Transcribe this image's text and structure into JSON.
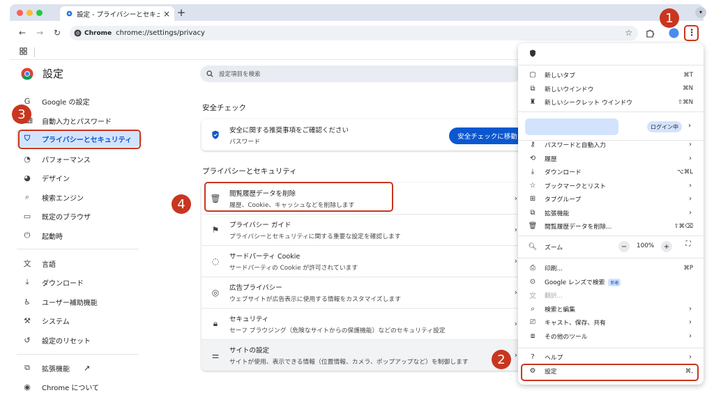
{
  "browser": {
    "tab_title": "設定 - プライバシーとセキュリティ",
    "tab_close": "×",
    "new_tab": "+",
    "site_chip": "Chrome",
    "url": "chrome://settings/privacy"
  },
  "settings": {
    "title": "設定",
    "search_placeholder": "設定項目を検索",
    "nav": [
      {
        "label": "Google の設定",
        "icon": "google-icon"
      },
      {
        "label": "自動入力とパスワード",
        "icon": "autofill-icon"
      },
      {
        "label": "プライバシーとセキュリティ",
        "icon": "shield-icon",
        "active": true
      },
      {
        "label": "パフォーマンス",
        "icon": "speedometer-icon"
      },
      {
        "label": "デザイン",
        "icon": "palette-icon"
      },
      {
        "label": "検索エンジン",
        "icon": "search-icon"
      },
      {
        "label": "既定のブラウザ",
        "icon": "browser-window-icon"
      },
      {
        "label": "起動時",
        "icon": "power-icon"
      },
      {
        "label": "言語",
        "icon": "translate-icon"
      },
      {
        "label": "ダウンロード",
        "icon": "download-icon"
      },
      {
        "label": "ユーザー補助機能",
        "icon": "accessibility-icon"
      },
      {
        "label": "システム",
        "icon": "wrench-icon"
      },
      {
        "label": "設定のリセット",
        "icon": "reset-icon"
      },
      {
        "label": "拡張機能",
        "icon": "puzzle-icon"
      },
      {
        "label": "Chrome について",
        "icon": "chrome-icon"
      }
    ],
    "safety_check": {
      "section_title": "安全チェック",
      "title": "安全に関する推奨事項をご確認ください",
      "subtitle": "パスワード",
      "button": "安全チェックに移動"
    },
    "privacy": {
      "section_title": "プライバシーとセキュリティ",
      "rows": [
        {
          "title": "閲覧履歴データを削除",
          "subtitle": "履歴、Cookie、キャッシュなどを削除します",
          "icon": "trash-icon"
        },
        {
          "title": "プライバシー ガイド",
          "subtitle": "プライバシーとセキュリティに関する重要な設定を確認します",
          "icon": "guide-icon"
        },
        {
          "title": "サードパーティ Cookie",
          "subtitle": "サードパーティの Cookie が許可されています",
          "icon": "cookie-icon"
        },
        {
          "title": "広告プライバシー",
          "subtitle": "ウェブサイトが広告表示に使用する情報をカスタマイズします",
          "icon": "ad-privacy-icon"
        },
        {
          "title": "セキュリティ",
          "subtitle": "セーフ ブラウジング（危険なサイトからの保護機能）などのセキュリティ設定",
          "icon": "lock-icon"
        },
        {
          "title": "サイトの設定",
          "subtitle": "サイトが使用、表示できる情報（位置情報、カメラ、ポップアップなど）を制御します",
          "icon": "sliders-icon"
        }
      ]
    }
  },
  "menu": {
    "items_top": [
      {
        "label": "新しいタブ",
        "shortcut": "⌘T",
        "icon": "new-tab-icon"
      },
      {
        "label": "新しいウインドウ",
        "shortcut": "⌘N",
        "icon": "new-window-icon"
      },
      {
        "label": "新しいシークレット ウインドウ",
        "shortcut": "⇧⌘N",
        "icon": "incognito-icon"
      }
    ],
    "profile_status": "ログイン中",
    "items_mid": [
      {
        "label": "パスワードと自動入力",
        "shortcut": "",
        "icon": "key-icon",
        "submenu": true
      },
      {
        "label": "履歴",
        "shortcut": "",
        "icon": "history-icon",
        "submenu": true
      },
      {
        "label": "ダウンロード",
        "shortcut": "⌥⌘L",
        "icon": "download-icon"
      },
      {
        "label": "ブックマークとリスト",
        "shortcut": "",
        "icon": "star-icon",
        "submenu": true
      },
      {
        "label": "タブグループ",
        "shortcut": "",
        "icon": "tab-groups-icon",
        "submenu": true
      },
      {
        "label": "拡張機能",
        "shortcut": "",
        "icon": "puzzle-icon",
        "submenu": true
      },
      {
        "label": "閲覧履歴データを削除...",
        "shortcut": "⇧⌘⌫",
        "icon": "trash-icon"
      }
    ],
    "zoom": {
      "label": "ズーム",
      "minus": "−",
      "value": "100%",
      "plus": "+"
    },
    "items_tools": [
      {
        "label": "印刷...",
        "shortcut": "⌘P",
        "icon": "print-icon"
      },
      {
        "label": "Google レンズで検索",
        "shortcut": "",
        "icon": "lens-icon",
        "badge": "新着"
      },
      {
        "label": "翻訳...",
        "shortcut": "",
        "icon": "translate-icon",
        "disabled": true
      },
      {
        "label": "検索と編集",
        "shortcut": "",
        "icon": "find-icon",
        "submenu": true
      },
      {
        "label": "キャスト、保存、共有",
        "shortcut": "",
        "icon": "cast-icon",
        "submenu": true
      },
      {
        "label": "その他のツール",
        "shortcut": "",
        "icon": "toolbox-icon",
        "submenu": true
      }
    ],
    "items_bottom": [
      {
        "label": "ヘルプ",
        "shortcut": "",
        "icon": "help-icon",
        "submenu": true
      },
      {
        "label": "設定",
        "shortcut": "⌘,",
        "icon": "gear-icon"
      }
    ]
  },
  "annotations": {
    "steps": [
      "1",
      "2",
      "3",
      "4"
    ],
    "highlight_color": "#c9361f"
  },
  "colors": {
    "accent": "#0b57d0",
    "active_nav_bg": "#d3e3fd",
    "tabstrip": "#dde3ee"
  }
}
